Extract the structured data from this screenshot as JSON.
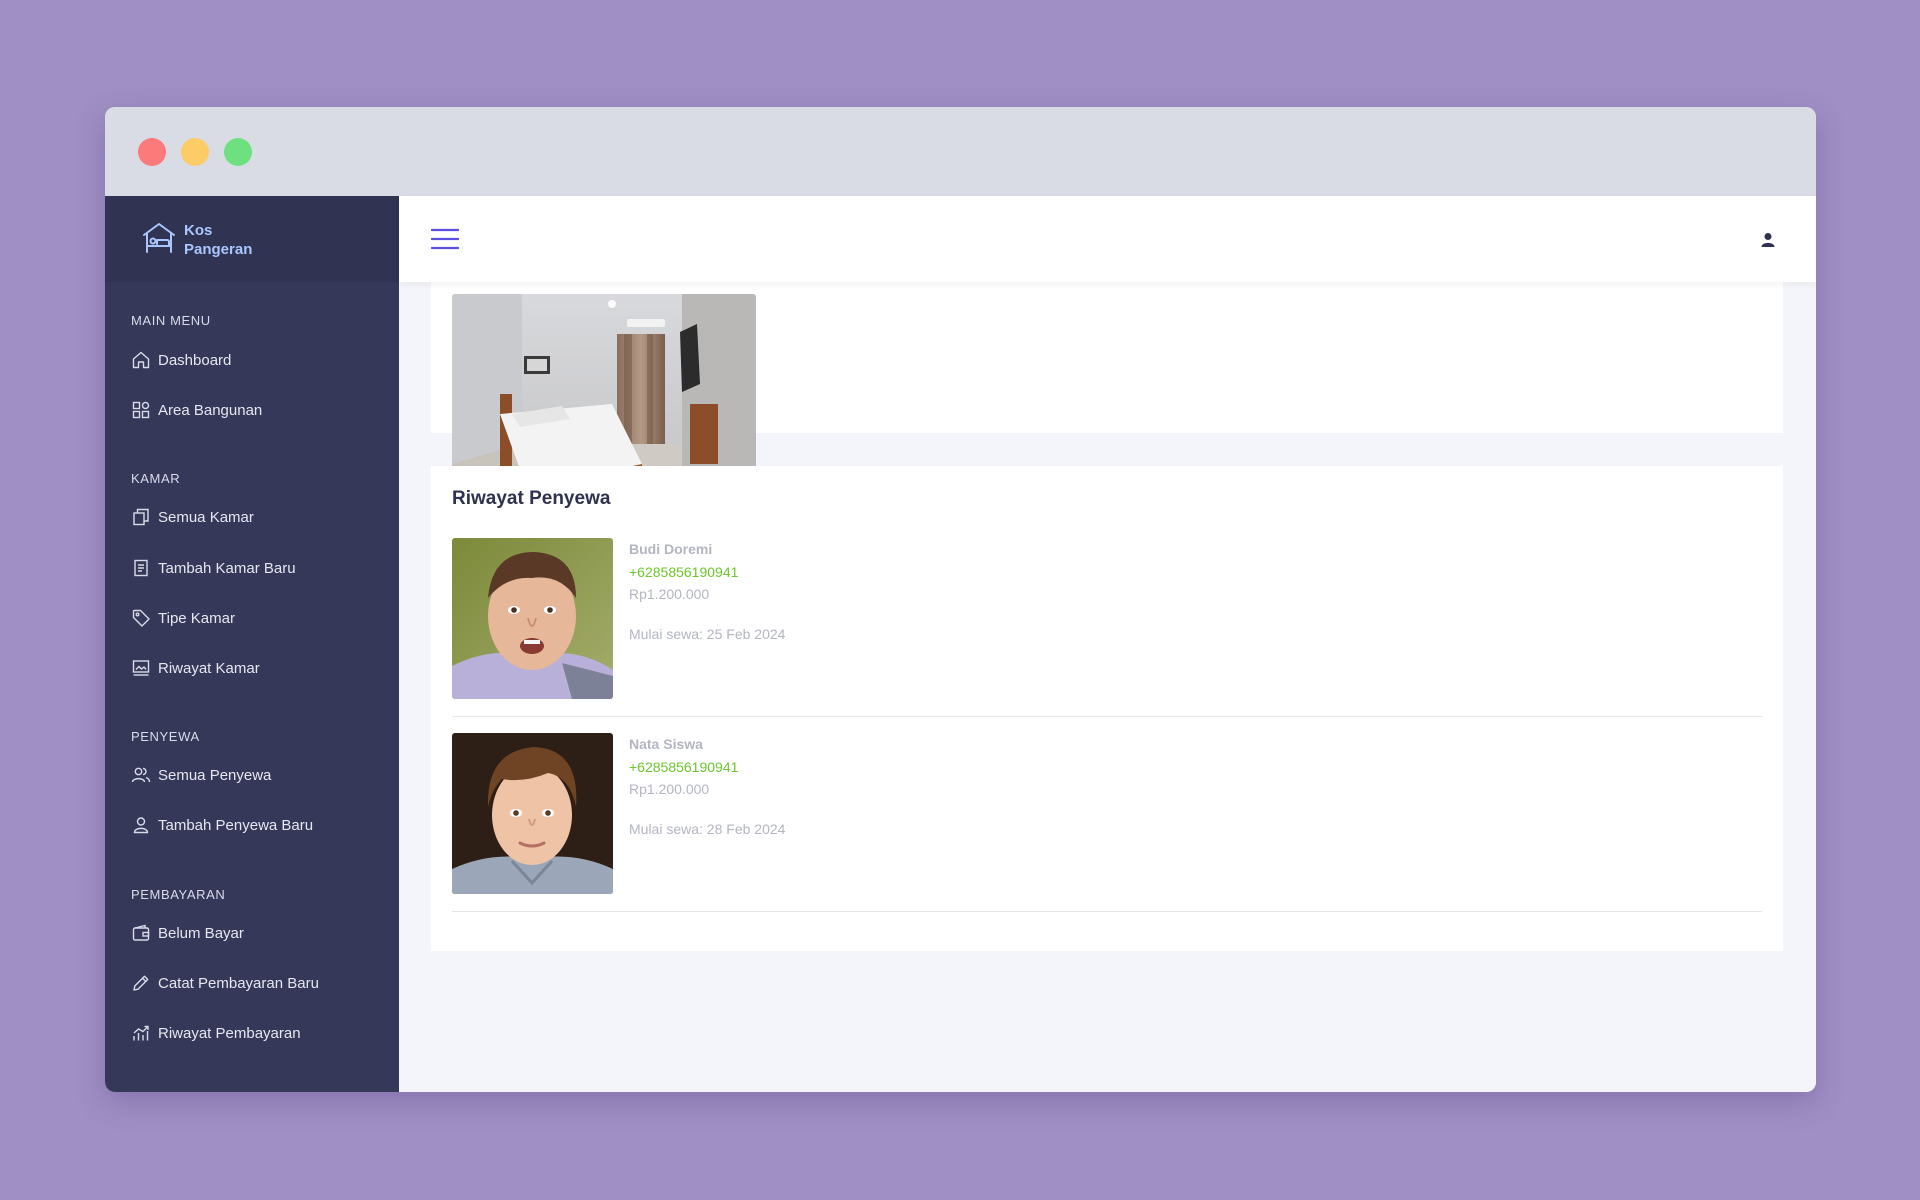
{
  "app": {
    "brand_line1": "Kos",
    "brand_line2": "Pangeran"
  },
  "sidebar": {
    "sections": [
      {
        "title": "MAIN MENU",
        "items": [
          {
            "label": "Dashboard",
            "icon": "home-icon"
          },
          {
            "label": "Area Bangunan",
            "icon": "grid-icon"
          }
        ]
      },
      {
        "title": "KAMAR",
        "items": [
          {
            "label": "Semua Kamar",
            "icon": "copy-icon"
          },
          {
            "label": "Tambah Kamar Baru",
            "icon": "document-icon"
          },
          {
            "label": "Tipe Kamar",
            "icon": "tag-icon"
          },
          {
            "label": "Riwayat Kamar",
            "icon": "image-icon"
          }
        ]
      },
      {
        "title": "PENYEWA",
        "items": [
          {
            "label": "Semua Penyewa",
            "icon": "users-icon"
          },
          {
            "label": "Tambah Penyewa Baru",
            "icon": "user-icon"
          }
        ]
      },
      {
        "title": "PEMBAYARAN",
        "items": [
          {
            "label": "Belum Bayar",
            "icon": "wallet-icon"
          },
          {
            "label": "Catat Pembayaran Baru",
            "icon": "pencil-icon"
          },
          {
            "label": "Riwayat Pembayaran",
            "icon": "chart-icon"
          }
        ]
      }
    ]
  },
  "topbar": {
    "menu_icon": "hamburger-icon",
    "account_icon": "user-icon"
  },
  "history": {
    "title": "Riwayat Penyewa",
    "tenants": [
      {
        "name": "Budi Doremi",
        "phone": "+6285856190941",
        "price": "Rp1.200.000",
        "start": "Mulai sewa: 25 Feb 2024"
      },
      {
        "name": "Nata Siswa",
        "phone": "+6285856190941",
        "price": "Rp1.200.000",
        "start": "Mulai sewa: 28 Feb 2024"
      }
    ]
  },
  "colors": {
    "background": "#a08fc4",
    "sidebar": "#363859",
    "accent": "#5b4fe0",
    "phone": "#6cc72b"
  }
}
